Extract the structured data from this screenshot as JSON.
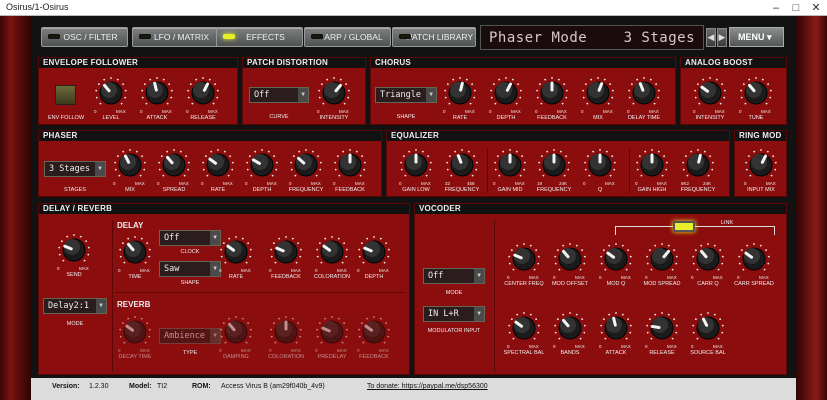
{
  "window": {
    "title": "Osirus/1-Osirus"
  },
  "tabs": [
    {
      "label": "OSC / FILTER",
      "active": false
    },
    {
      "label": "LFO / MATRIX",
      "active": false
    },
    {
      "label": "EFFECTS",
      "active": true
    },
    {
      "label": "ARP / GLOBAL",
      "active": false
    },
    {
      "label": "PATCH LIBRARY",
      "active": false
    }
  ],
  "lcd": {
    "left": "Phaser Mode",
    "right": "3 Stages"
  },
  "menu": {
    "label": "MENU"
  },
  "panels": {
    "env": {
      "title": "ENVELOPE FOLLOWER",
      "button_label": "ENV FOLLOW",
      "knobs": [
        {
          "label": "LEVEL",
          "value": 0.35
        },
        {
          "label": "ATTACK",
          "value": 0.45
        },
        {
          "label": "RELEASE",
          "value": 0.6
        }
      ]
    },
    "dist": {
      "title": "PATCH DISTORTION",
      "curve": "Off",
      "curve_label": "CURVE",
      "knobs": [
        {
          "label": "INTENSITY",
          "value": 0.65
        }
      ]
    },
    "chorus": {
      "title": "CHORUS",
      "shape": "Triangle",
      "shape_label": "SHAPE",
      "knobs": [
        {
          "label": "RATE",
          "value": 0.55
        },
        {
          "label": "DEPTH",
          "value": 0.6
        },
        {
          "label": "FEEDBACK",
          "value": 0.5
        },
        {
          "label": "MIX",
          "value": 0.58
        },
        {
          "label": "DELAY TIME",
          "value": 0.42
        }
      ]
    },
    "boost": {
      "title": "ANALOG BOOST",
      "knobs": [
        {
          "label": "INTENSITY",
          "value": 0.3
        },
        {
          "label": "TUNE",
          "value": 0.35
        }
      ]
    },
    "phaser": {
      "title": "PHASER",
      "stages": "3 Stages",
      "stages_label": "STAGES",
      "knobs": [
        {
          "label": "MIX",
          "value": 0.4
        },
        {
          "label": "SPREAD",
          "value": 0.35
        },
        {
          "label": "RATE",
          "value": 0.3
        },
        {
          "label": "DEPTH",
          "value": 0.28
        },
        {
          "label": "FREQUENCY",
          "value": 0.32
        },
        {
          "label": "FEEDBACK",
          "value": 0.5
        }
      ]
    },
    "eq": {
      "title": "EQUALIZER",
      "knobs": [
        {
          "label": "GAIN LOW",
          "value": 0.5,
          "min": "0",
          "max": "MAX"
        },
        {
          "label": "FREQUENCY",
          "value": 0.42,
          "min": "32",
          "max": "458"
        },
        {
          "label": "GAIN MID",
          "value": 0.5,
          "min": "0",
          "max": "MAX"
        },
        {
          "label": "FREQUENCY",
          "value": 0.5,
          "min": "19",
          "max": "24K"
        },
        {
          "label": "Q",
          "value": 0.5,
          "min": "0",
          "max": "MAX"
        },
        {
          "label": "GAIN HIGH",
          "value": 0.5,
          "min": "0",
          "max": "MAX"
        },
        {
          "label": "FREQUENCY",
          "value": 0.55,
          "min": "8K2",
          "max": "24K"
        }
      ]
    },
    "ring": {
      "title": "RING MOD",
      "knobs": [
        {
          "label": "INPUT MIX",
          "value": 0.6
        }
      ]
    },
    "delay": {
      "title": "DELAY / REVERB",
      "delay_label": "DELAY",
      "reverb_label": "REVERB",
      "mode": "Delay2:1",
      "mode_label": "MODE",
      "send_knob": {
        "label": "SEND",
        "value": 0.25
      },
      "clock": "Off",
      "clock_label": "CLOCK",
      "shape": "Saw",
      "shape_label": "SHAPE",
      "type": "Ambience",
      "type_label": "TYPE",
      "delay_knobs": [
        {
          "label": "TIME",
          "value": 0.35
        },
        {
          "label": "RATE",
          "value": 0.3
        },
        {
          "label": "FEEDBACK",
          "value": 0.25
        },
        {
          "label": "COLORATION",
          "value": 0.3
        },
        {
          "label": "DEPTH",
          "value": 0.25
        }
      ],
      "reverb_knobs": [
        {
          "label": "DECAY TIME",
          "value": 0.3
        },
        {
          "label": "DAMPING",
          "value": 0.35
        },
        {
          "label": "COLORATION",
          "value": 0.5
        },
        {
          "label": "PREDELAY",
          "value": 0.25
        },
        {
          "label": "FEEDBACK",
          "value": 0.3
        }
      ]
    },
    "vocoder": {
      "title": "VOCODER",
      "mode": "Off",
      "mode_label": "MODE",
      "mod_input": "IN L+R",
      "mod_input_label": "MODULATOR INPUT",
      "link_label": "LINK",
      "knobs_top": [
        {
          "label": "CENTER FREQ",
          "value": 0.25
        },
        {
          "label": "MOD OFFSET",
          "value": 0.35
        },
        {
          "label": "MOD Q",
          "value": 0.3
        },
        {
          "label": "MOD SPREAD",
          "value": 0.65
        },
        {
          "label": "CARR Q",
          "value": 0.35
        },
        {
          "label": "CARR SPREAD",
          "value": 0.3
        }
      ],
      "knobs_bottom": [
        {
          "label": "SPECTRAL BAL",
          "value": 0.3
        },
        {
          "label": "BANDS",
          "value": 0.35
        },
        {
          "label": "ATTACK",
          "value": 0.45
        },
        {
          "label": "RELEASE",
          "value": 0.2
        },
        {
          "label": "SOURCE BAL",
          "value": 0.4
        }
      ]
    }
  },
  "status": {
    "version_label": "Version:",
    "version": "1.2.30",
    "model_label": "Model:",
    "model": "TI2",
    "rom_label": "ROM:",
    "rom": "Access Virus B (am29f040b_4v9)",
    "donate": "To donate: https://paypal.me/dsp56300"
  },
  "colors": {
    "panel": "#8c0d0d",
    "led_active": "#e8ef2a"
  }
}
